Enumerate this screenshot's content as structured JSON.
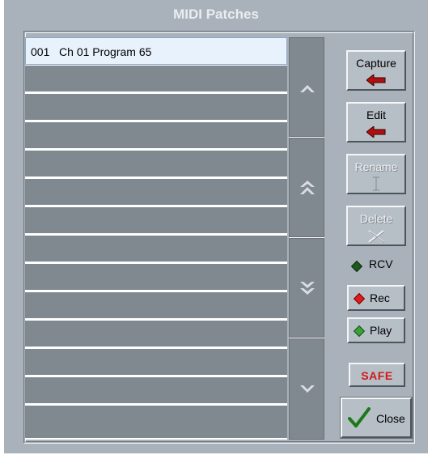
{
  "window": {
    "title": "MIDI Patches"
  },
  "patch_list": {
    "selected_row": "001   Ch 01 Program 65",
    "empty_rows": 13
  },
  "scroll": {
    "buttons": [
      {
        "name": "scroll-up-button",
        "icon": "chevron-up-icon"
      },
      {
        "name": "page-up-button",
        "icon": "double-chevron-up-icon"
      },
      {
        "name": "page-down-button",
        "icon": "double-chevron-down-icon"
      },
      {
        "name": "scroll-down-button",
        "icon": "chevron-down-icon"
      }
    ]
  },
  "buttons": {
    "capture": {
      "label": "Capture",
      "icon": "red-arrow-left-icon",
      "enabled": true
    },
    "edit": {
      "label": "Edit",
      "icon": "red-arrow-left-icon",
      "enabled": true
    },
    "rename": {
      "label": "Rename",
      "icon": "text-cursor-icon",
      "enabled": false
    },
    "delete": {
      "label": "Delete",
      "icon": "x-icon",
      "enabled": false
    }
  },
  "status": {
    "rcv": {
      "label": "RCV",
      "led_color": "#1e5a1e"
    },
    "rec": {
      "label": "Rec",
      "led_color": "#e01c1c"
    },
    "play": {
      "label": "Play",
      "led_color": "#3aa03a"
    }
  },
  "safe": {
    "label": "SAFE",
    "color": "#d01818"
  },
  "close": {
    "label": "Close",
    "icon": "checkmark-icon",
    "color": "#1a7a1a"
  }
}
